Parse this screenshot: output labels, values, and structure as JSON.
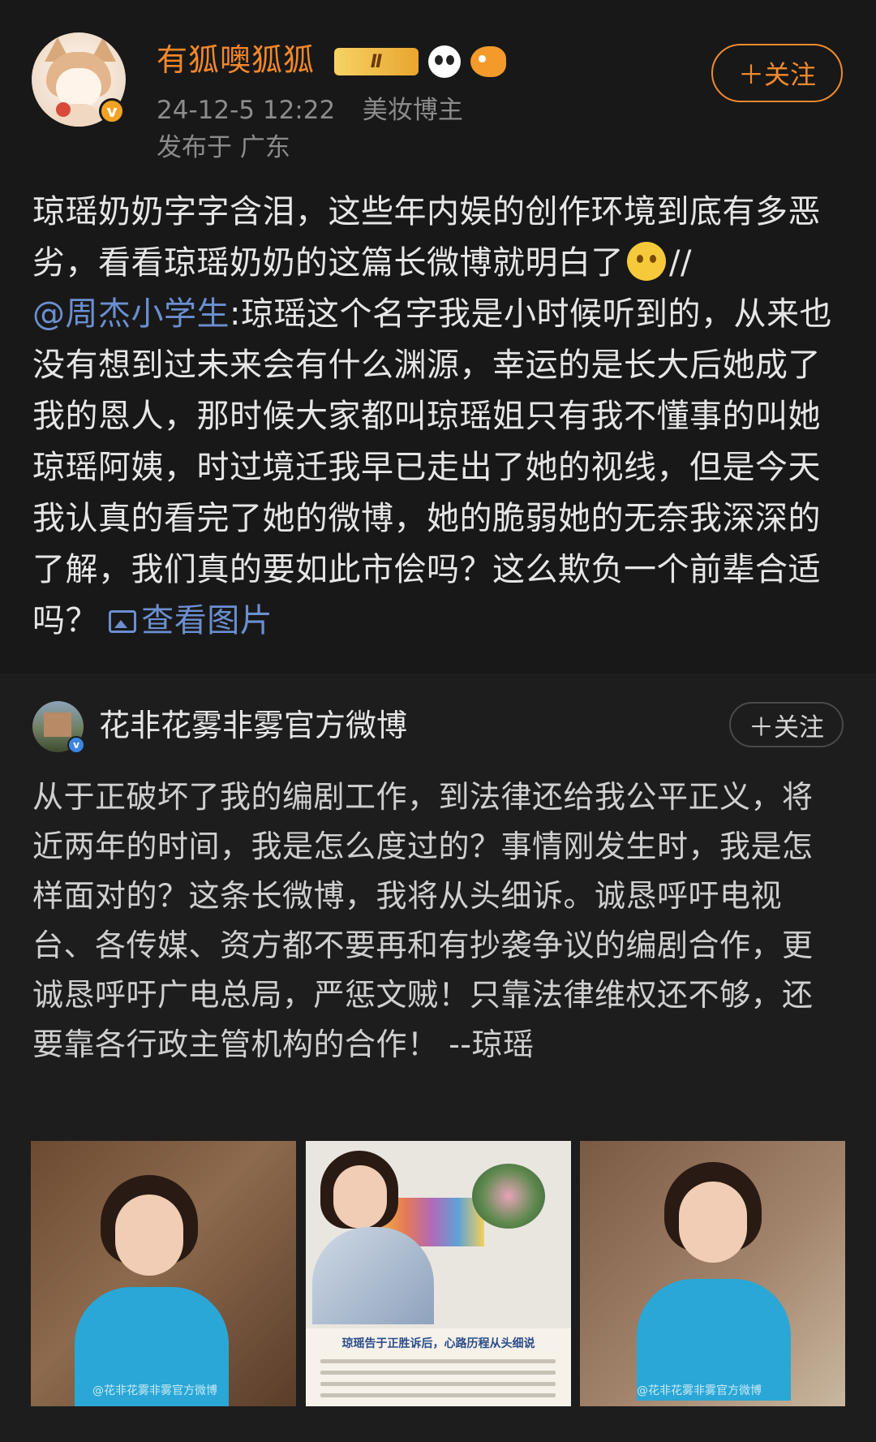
{
  "post": {
    "username": "有狐噢狐狐",
    "level_badge": "Ⅱ",
    "timestamp": "24-12-5 12:22",
    "user_tag": "美妆博主",
    "location": "发布于 广东",
    "follow_label": "＋关注",
    "text_before_emoji": "琼瑶奶奶字字含泪，这些年内娱的创作环境到底有多恶劣，看看琼瑶奶奶的这篇长微博就明白了",
    "slashes": "//",
    "mention": "@周杰小学生",
    "text_after_mention": ":琼瑶这个名字我是小时候听到的，从来也没有想到过未来会有什么渊源，幸运的是长大后她成了我的恩人，那时候大家都叫琼瑶姐只有我不懂事的叫她琼瑶阿姨，时过境迁我早已走出了她的视线，但是今天我认真的看完了她的微博，她的脆弱她的无奈我深深的了解，我们真的要如此市侩吗？这么欺负一个前辈合适吗？",
    "view_images_label": "查看图片"
  },
  "repost": {
    "username": "花非花雾非雾官方微博",
    "follow_label": "＋关注",
    "text": "从于正破坏了我的编剧工作，到法律还给我公平正义，将近两年的时间，我是怎么度过的？事情刚发生时，我是怎样面对的？这条长微博，我将从头细诉。诚恳呼吁电视台、各传媒、资方都不要再和有抄袭争议的编剧合作，更诚恳呼吁广电总局，严惩文贼！只靠法律维权还不够，还要靠各行政主管机构的合作！ --琼瑶",
    "images": [
      {
        "watermark": "@花非花雾非雾官方微博"
      },
      {
        "caption": "琼瑶告于正胜诉后，心路历程从头细说"
      },
      {
        "watermark": "@花非花雾非雾官方微博"
      }
    ]
  },
  "colors": {
    "background": "#181818",
    "username_orange": "#f4882b",
    "link_blue": "#6b8fd0",
    "verified_orange": "#f3a224",
    "verified_blue": "#3a86e0"
  },
  "icons": [
    "verified-badge-icon",
    "level-badge-icon",
    "panda-badge-icon",
    "fish-badge-icon",
    "crying-emoji-icon",
    "image-icon"
  ]
}
